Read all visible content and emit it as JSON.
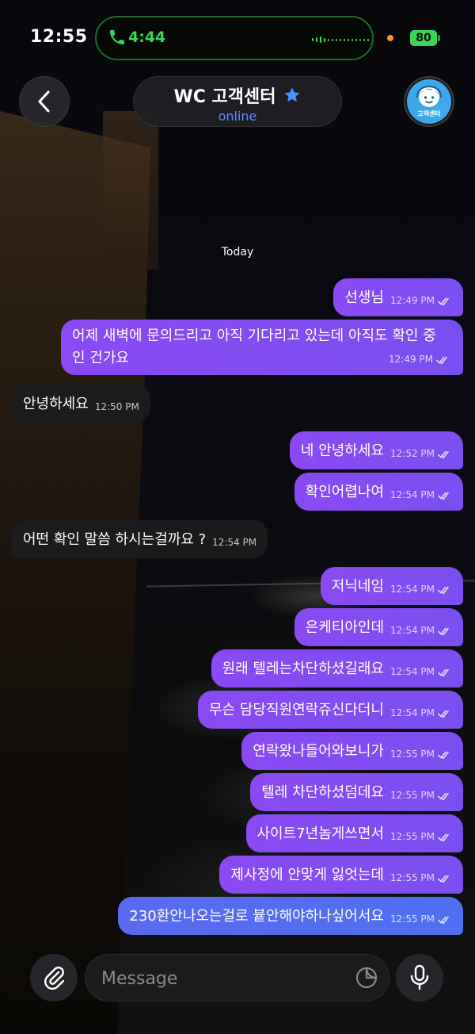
{
  "status_bar": {
    "time": "12:55",
    "call_time": "4:44",
    "battery": "80"
  },
  "header": {
    "title": "WC 고객센터",
    "subtitle": "online",
    "avatar_label": "고객센터"
  },
  "date_chip": "Today",
  "messages": [
    {
      "dir": "out",
      "text": "선생님",
      "time": "12:49 PM"
    },
    {
      "dir": "out",
      "text": "어제 새벽에 문의드리고 아직 기다리고 있는데 아직도 확인 중인 건가요",
      "time": "12:49 PM"
    },
    {
      "dir": "in",
      "text": "안녕하세요",
      "time": "12:50 PM"
    },
    {
      "dir": "out",
      "text": "네 안녕하세요",
      "time": "12:52 PM"
    },
    {
      "dir": "out",
      "text": "확인어렵나여",
      "time": "12:54 PM"
    },
    {
      "dir": "in",
      "text": "어떤 확인 말씀 하시는걸까요 ?",
      "time": "12:54 PM"
    },
    {
      "dir": "out",
      "text": "저닉네임",
      "time": "12:54 PM"
    },
    {
      "dir": "out",
      "text": "은케티아인데",
      "time": "12:54 PM"
    },
    {
      "dir": "out",
      "text": "원래 텔레는차단하셨길래요",
      "time": "12:54 PM"
    },
    {
      "dir": "out",
      "text": "무슨 담당직원연락쥬신다더니",
      "time": "12:54 PM"
    },
    {
      "dir": "out",
      "text": "연락왔나들어와보니가",
      "time": "12:55 PM"
    },
    {
      "dir": "out",
      "text": "텔레 차단하셨덤데요",
      "time": "12:55 PM"
    },
    {
      "dir": "out",
      "text": "사이트7년놈게쓰면서",
      "time": "12:55 PM"
    },
    {
      "dir": "out",
      "text": "제사정에 안맞게 잃엇는데",
      "time": "12:55 PM"
    },
    {
      "dir": "out",
      "text": "230환안나오는걸로 븉안해야하나싶어서요",
      "time": "12:55 PM"
    }
  ],
  "composer": {
    "placeholder": "Message"
  },
  "colors": {
    "accent": "#5b8cff",
    "outgoing_bubble": "#8a49f2",
    "call_green": "#3ad45a"
  }
}
